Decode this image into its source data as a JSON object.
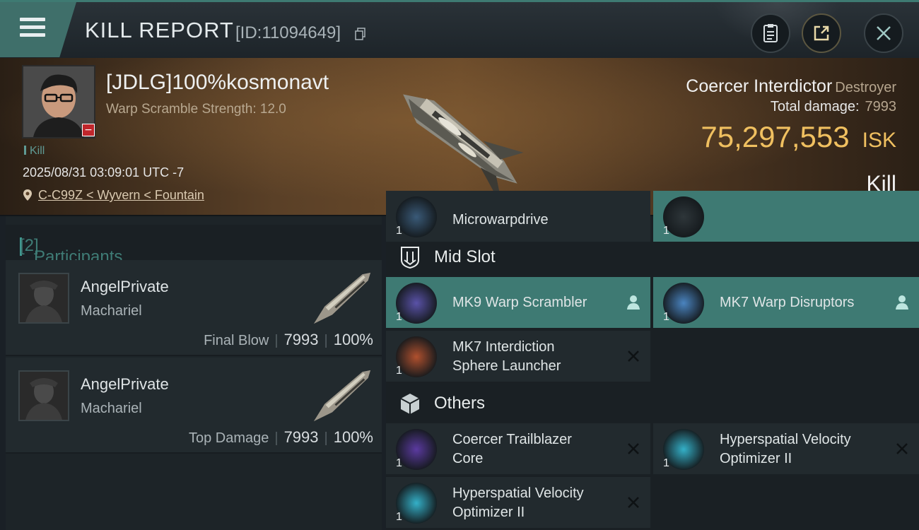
{
  "header": {
    "title": "KILL REPORT",
    "report_id": "[ID:11094649]",
    "buttons": [
      "report-button",
      "share-button",
      "close-button"
    ]
  },
  "victim": {
    "name": "[JDLG]100%kosmonavt",
    "subtitle": "Warp Scramble Strength: 12.0",
    "tag": "Kill",
    "datetime": "2025/08/31 03:09:01 UTC -7",
    "location": "C-C99Z < Wyvern < Fountain",
    "ship_name": "Coercer Interdictor",
    "ship_class": "Destroyer",
    "total_damage_label": "Total damage:",
    "total_damage": "7993",
    "isk_value": "75,297,553",
    "isk_label": "ISK",
    "result": "Kill"
  },
  "participants": {
    "header": "Participants",
    "count": "[2]",
    "rows": [
      {
        "name": "AngelPrivate",
        "ship": "Machariel",
        "role": "Final Blow",
        "damage": "7993",
        "percent": "100%"
      },
      {
        "name": "AngelPrivate",
        "ship": "Machariel",
        "role": "Top Damage",
        "damage": "7993",
        "percent": "100%"
      }
    ]
  },
  "fittings": {
    "partial_top": [
      {
        "label": "Microwarpdrive",
        "qty": "1"
      },
      {
        "label": "",
        "qty": "1"
      }
    ],
    "mid_slot": {
      "title": "Mid Slot",
      "items": [
        {
          "label": "MK9 Warp Scrambler",
          "qty": "1",
          "state": "dropped"
        },
        {
          "label": "MK7 Warp Disruptors",
          "qty": "1",
          "state": "dropped"
        },
        {
          "label_1": "MK7 Interdiction",
          "label_2": "Sphere Launcher",
          "qty": "1",
          "state": "destroyed"
        }
      ]
    },
    "others": {
      "title": "Others",
      "items": [
        {
          "label_1": "Coercer Trailblazer",
          "label_2": "Core",
          "qty": "1",
          "state": "destroyed"
        },
        {
          "label_1": "Hyperspatial Velocity",
          "label_2": "Optimizer II",
          "qty": "1",
          "state": "destroyed"
        },
        {
          "label_1": "Hyperspatial Velocity",
          "label_2": "Optimizer II",
          "qty": "1",
          "state": "destroyed"
        }
      ]
    }
  },
  "colors": {
    "accent_teal": "#3e7a73",
    "isk_gold": "#f0c060",
    "panel_bg": "#1a2024"
  }
}
